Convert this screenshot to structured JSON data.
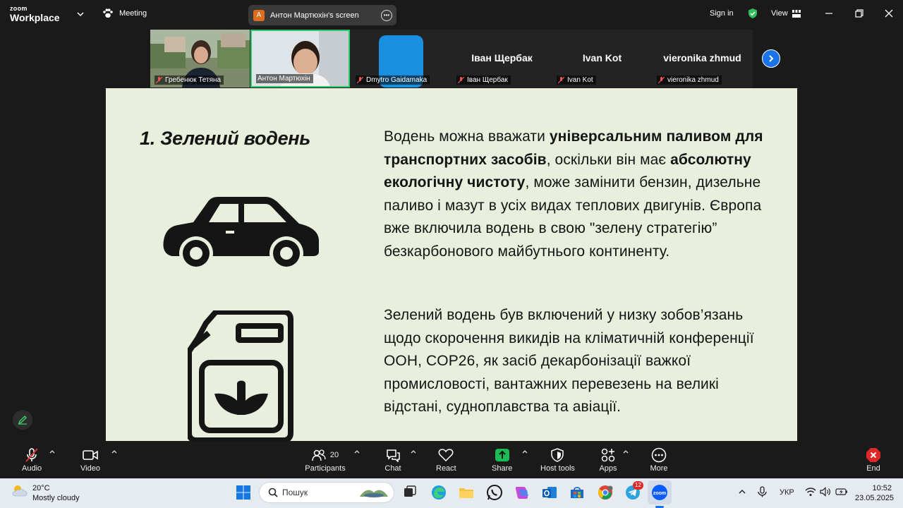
{
  "app": {
    "logo_line1": "zoom",
    "logo_line2": "Workplace",
    "meeting_label": "Meeting",
    "screen_owner_initial": "A",
    "screen_label": "Антон Мартюхін's screen",
    "sign_in": "Sign in",
    "view": "View"
  },
  "gallery": {
    "tiles": [
      {
        "name": "Гребенюк Тетяна",
        "big": ""
      },
      {
        "name": "Антон Мартюхін",
        "big": ""
      },
      {
        "name": "Dmytro Gaidamaka",
        "big": ""
      },
      {
        "name": "Іван Щербак",
        "big": "Іван Щербак"
      },
      {
        "name": "Ivan Kot",
        "big": "Ivan Kot"
      },
      {
        "name": "vieronika zhmud",
        "big": "vieronika zhmud"
      }
    ]
  },
  "slide": {
    "title": "1. Зелений водень",
    "p1": [
      {
        "t": "Водень можна вважати ",
        "b": false
      },
      {
        "t": "універсальним паливом для транспортних засобів",
        "b": true
      },
      {
        "t": ", оскільки він має ",
        "b": false
      },
      {
        "t": "абсолютну екологічну чистоту",
        "b": true
      },
      {
        "t": ", може замінити бензин, дизельне паливо і мазут в усіх видах теплових двигунів. Європа вже включила водень в свою \"зелену стратегію” безкарбонового майбутнього континенту.",
        "b": false
      }
    ],
    "p2": "Зелений водень був включений у низку зобов’язань щодо скорочення викидів на кліматичній конференції ООН, COP26, як засіб декарбонізації важкої промисловості, вантажних перевезень на великі відстані, судноплавства та авіації."
  },
  "toolbar": {
    "audio": "Audio",
    "video": "Video",
    "participants": "Participants",
    "participants_count": "20",
    "chat": "Chat",
    "react": "React",
    "share": "Share",
    "host_tools": "Host tools",
    "apps": "Apps",
    "more": "More",
    "end": "End"
  },
  "taskbar": {
    "temp": "20°C",
    "weather": "Mostly cloudy",
    "search_placeholder": "Пошук",
    "telegram_badge": "12",
    "lang": "УКР",
    "time": "10:52",
    "date": "23.05.2025"
  },
  "colors": {
    "zoom_blue": "#1a73e8",
    "active_speaker": "#2ecc71",
    "share_green": "#1db954",
    "end_red": "#e02828",
    "slide_bg": "#e8efdc"
  }
}
